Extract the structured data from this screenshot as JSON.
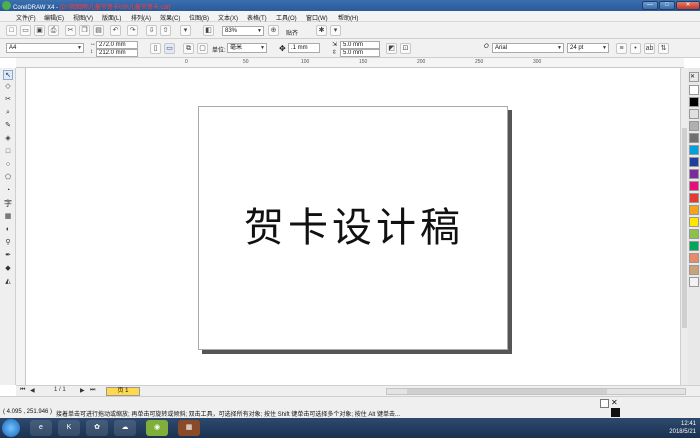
{
  "window": {
    "title_app": "CorelDRAW X4 - ",
    "title_path": "[D:\\我图网\\儿童节贺卡\\09\\儿童节贺卡.cdr]",
    "min": "—",
    "max": "□",
    "close": "✕"
  },
  "menu": [
    "文件(F)",
    "编辑(E)",
    "视图(V)",
    "版面(L)",
    "排列(A)",
    "效果(C)",
    "位图(B)",
    "文本(X)",
    "表格(T)",
    "工具(O)",
    "窗口(W)",
    "帮助(H)"
  ],
  "toolbar": {
    "zoom": "83%",
    "snap": "贴齐"
  },
  "propbar": {
    "paper": "A4",
    "width": "272.0 mm",
    "height": "212.0 mm",
    "units_label": "单位:",
    "units": "毫米",
    "nudge": ".1 mm",
    "dup_x": "5.0 mm",
    "dup_y": "5.0 mm",
    "font_name": "Arial",
    "font_size": "24 pt"
  },
  "ruler_top_ticks": [
    "0",
    "50",
    "100",
    "150",
    "200",
    "250",
    "300"
  ],
  "page": {
    "text": "贺卡设计稿"
  },
  "pagebar": {
    "page_counter": "1 / 1",
    "page_tab": "页 1"
  },
  "status": {
    "coords": "( 4.095 , 251.946 )",
    "hint": "接着单击可进行拖动或缩放; 再单击可旋转或倾斜; 双击工具，可选择所有对象; 按住 Shift 键单击可选择多个对象; 按住 Alt 键单击..."
  },
  "taskbar": {
    "time": "12:41",
    "date": "2018/5/21"
  },
  "palette_colors": [
    "#ffffff",
    "#000000",
    "#e0e0e0",
    "#b0b0b0",
    "#707070",
    "#00a0e0",
    "#1e3f9c",
    "#7a2c9a",
    "#e2127a",
    "#e53935",
    "#f6a21e",
    "#ffe600",
    "#8bc34a",
    "#00a65a",
    "#e88a6a",
    "#c9a27a",
    "#f2f2f2"
  ]
}
